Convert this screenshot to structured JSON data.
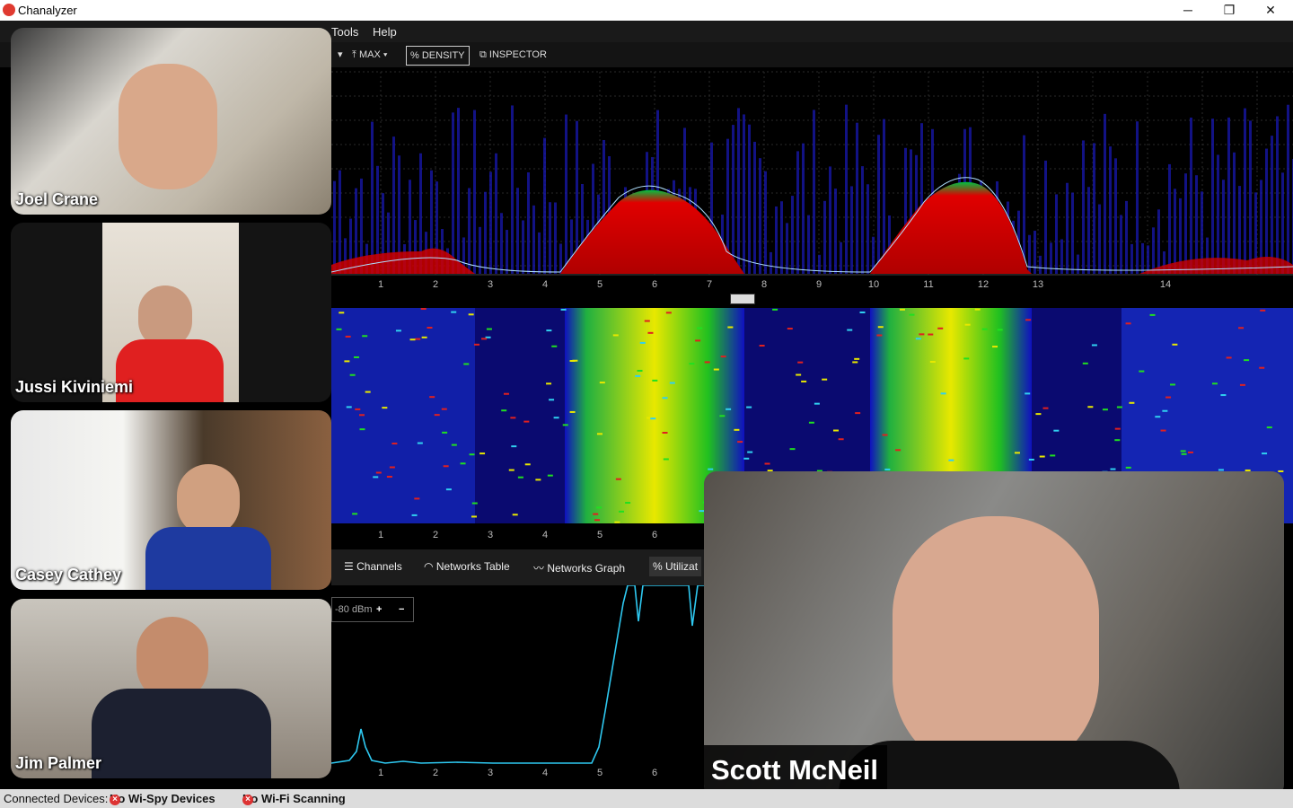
{
  "app": {
    "title": "Chanalyzer"
  },
  "window_controls": {
    "minimize": "─",
    "restore": "❐",
    "close": "✕"
  },
  "menu": {
    "tools": "Tools",
    "help": "Help"
  },
  "toolbar": {
    "max_label": "MAX",
    "density_label": "DENSITY",
    "inspector_label": "INSPECTOR"
  },
  "spectrum": {
    "channel_labels": [
      "1",
      "2",
      "3",
      "4",
      "5",
      "6",
      "7",
      "8",
      "9",
      "10",
      "11",
      "12",
      "13",
      "14"
    ],
    "waterfall_channel_labels": [
      "1",
      "2",
      "3",
      "4",
      "5",
      "6"
    ],
    "lower_channel_labels": [
      "1",
      "2",
      "3",
      "4",
      "5",
      "6"
    ]
  },
  "tabs": {
    "channels": "Channels",
    "networks_table": "Networks Table",
    "networks_graph": "Networks Graph",
    "utilization": "Utilizat"
  },
  "graph_controls": {
    "dbm_label": "-80 dBm",
    "plus": "+",
    "minus": "−"
  },
  "participants": [
    {
      "name": "Joel Crane"
    },
    {
      "name": "Jussi Kiviniemi"
    },
    {
      "name": "Casey Cathey"
    },
    {
      "name": "Jim Palmer"
    },
    {
      "name": "Scott McNeil"
    }
  ],
  "status": {
    "connected_label": "Connected Devices:",
    "wispy": "No Wi-Spy Devices",
    "wifi": "No Wi-Fi Scanning"
  },
  "colors": {
    "heat_red": "#c00000",
    "heat_yellow": "#e8e800",
    "heat_green": "#20c020",
    "heat_blue": "#1010c0",
    "trace_cyan": "#2ec8f0"
  }
}
